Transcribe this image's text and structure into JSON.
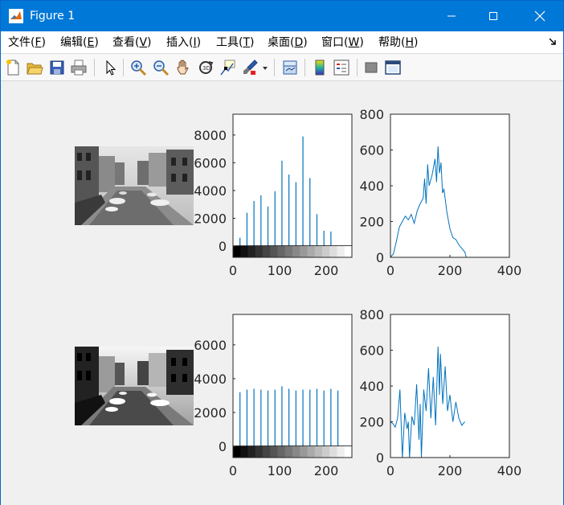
{
  "window": {
    "title": "Figure 1"
  },
  "menu": [
    {
      "label": "文件(",
      "key": "F",
      "tail": ")"
    },
    {
      "label": "编辑(",
      "key": "E",
      "tail": ")"
    },
    {
      "label": "查看(",
      "key": "V",
      "tail": ")"
    },
    {
      "label": "插入(",
      "key": "I",
      "tail": ")"
    },
    {
      "label": "工具(",
      "key": "T",
      "tail": ")"
    },
    {
      "label": "桌面(",
      "key": "D",
      "tail": ")"
    },
    {
      "label": "窗口(",
      "key": "W",
      "tail": ")"
    },
    {
      "label": "帮助(",
      "key": "H",
      "tail": ")"
    }
  ],
  "toolbar": {
    "icons": [
      "new-figure-icon",
      "open-file-icon",
      "save-icon",
      "print-icon",
      "select-arrow-icon",
      "zoom-in-icon",
      "zoom-out-icon",
      "pan-hand-icon",
      "rotate-3d-icon",
      "data-cursor-icon",
      "brush-icon",
      "brush-dropdown-icon",
      "link-plot-icon",
      "colorbar-icon",
      "legend-icon",
      "hide-plot-tools-icon",
      "show-plot-tools-icon"
    ]
  },
  "colors": {
    "plot_blue": "#0072bd",
    "axis": "#262626",
    "titlebar": "#0078d7"
  },
  "chart_data": [
    {
      "type": "bar",
      "id": "hist-original",
      "xlim": [
        0,
        255
      ],
      "ylim": [
        0,
        9500
      ],
      "xticks": [
        "0",
        "100",
        "200"
      ],
      "yticks": [
        "0",
        "2000",
        "4000",
        "6000",
        "8000"
      ],
      "bins": [
        15,
        30,
        45,
        60,
        75,
        90,
        105,
        120,
        135,
        150,
        165,
        180,
        195,
        210,
        225,
        240
      ],
      "values": [
        600,
        2400,
        3250,
        3650,
        2850,
        3950,
        6150,
        5150,
        4600,
        7900,
        4900,
        2300,
        1100,
        1050,
        0,
        0
      ],
      "grayscale_colorbar": true
    },
    {
      "type": "line",
      "id": "profile-original",
      "xlim": [
        0,
        400
      ],
      "ylim": [
        0,
        800
      ],
      "xticks": [
        "0",
        "200",
        "400"
      ],
      "yticks": [
        "0",
        "200",
        "400",
        "600",
        "800"
      ],
      "x": [
        0,
        10,
        20,
        30,
        40,
        50,
        60,
        70,
        80,
        90,
        100,
        110,
        115,
        120,
        125,
        130,
        140,
        150,
        155,
        160,
        165,
        170,
        175,
        180,
        190,
        200,
        210,
        220,
        230,
        240,
        245,
        250,
        255
      ],
      "y": [
        0,
        20,
        90,
        170,
        200,
        230,
        210,
        240,
        190,
        260,
        300,
        330,
        440,
        300,
        520,
        400,
        460,
        550,
        420,
        620,
        470,
        530,
        360,
        380,
        250,
        160,
        110,
        100,
        70,
        50,
        40,
        30,
        0
      ]
    },
    {
      "type": "bar",
      "id": "hist-equalized",
      "xlim": [
        0,
        255
      ],
      "ylim": [
        0,
        7800
      ],
      "xticks": [
        "0",
        "100",
        "200"
      ],
      "yticks": [
        "0",
        "2000",
        "4000",
        "6000"
      ],
      "bins": [
        15,
        30,
        45,
        60,
        75,
        90,
        105,
        120,
        135,
        150,
        165,
        180,
        195,
        210,
        225,
        240
      ],
      "values": [
        3200,
        3350,
        3400,
        3350,
        3300,
        3350,
        3550,
        3400,
        3300,
        3350,
        3350,
        3400,
        3300,
        3400,
        3300,
        0
      ],
      "grayscale_colorbar": true
    },
    {
      "type": "line",
      "id": "profile-equalized",
      "xlim": [
        0,
        400
      ],
      "ylim": [
        0,
        800
      ],
      "xticks": [
        "0",
        "200",
        "400"
      ],
      "yticks": [
        "0",
        "200",
        "400",
        "600",
        "800"
      ],
      "x": [
        0,
        8,
        16,
        24,
        32,
        40,
        48,
        56,
        60,
        64,
        72,
        80,
        88,
        96,
        100,
        104,
        112,
        120,
        128,
        136,
        144,
        152,
        160,
        165,
        168,
        176,
        184,
        192,
        200,
        210,
        220,
        230,
        240,
        250
      ],
      "y": [
        200,
        190,
        170,
        220,
        380,
        0,
        250,
        160,
        200,
        0,
        230,
        180,
        410,
        100,
        300,
        0,
        380,
        260,
        500,
        220,
        450,
        180,
        620,
        350,
        580,
        300,
        510,
        260,
        350,
        200,
        310,
        220,
        180,
        200
      ]
    }
  ]
}
